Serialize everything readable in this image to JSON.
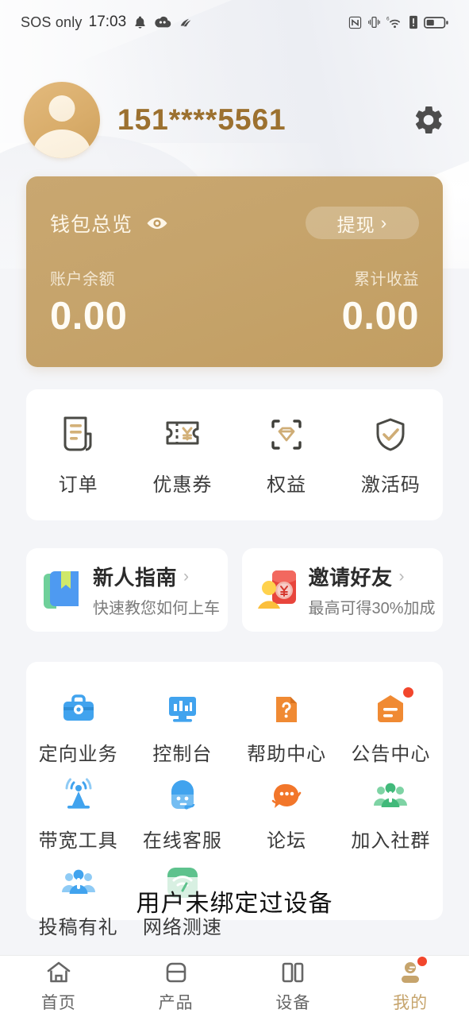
{
  "status_bar": {
    "carrier": "SOS only",
    "time": "17:03",
    "left_icons": [
      "bell-icon",
      "cloud-icon",
      "swoosh-icon"
    ],
    "right_icons": [
      "nfc-icon",
      "vibrate-icon",
      "wifi6-icon",
      "signal-alert-icon",
      "battery-icon"
    ]
  },
  "header": {
    "phone_number": "151****5561",
    "settings_icon": "gear-icon",
    "avatar": "user-avatar"
  },
  "wallet": {
    "title": "钱包总览",
    "eye_icon": "eye-icon",
    "withdraw_label": "提现",
    "balance_label": "账户余额",
    "balance_value": "0.00",
    "earnings_label": "累计收益",
    "earnings_value": "0.00",
    "card_color": "#c6a46c"
  },
  "quick_actions": [
    {
      "label": "订单",
      "icon": "document-icon"
    },
    {
      "label": "优惠券",
      "icon": "coupon-yen-icon"
    },
    {
      "label": "权益",
      "icon": "diamond-scan-icon"
    },
    {
      "label": "激活码",
      "icon": "shield-check-icon"
    }
  ],
  "banners": [
    {
      "title": "新人指南",
      "subtitle": "快速教您如何上车",
      "icon": "book-icon"
    },
    {
      "title": "邀请好友",
      "subtitle": "最高可得30%加成",
      "icon": "invite-redpacket-icon"
    }
  ],
  "services": [
    {
      "label": "定向业务",
      "icon": "briefcase-icon",
      "badge": false
    },
    {
      "label": "控制台",
      "icon": "monitor-chart-icon",
      "badge": false
    },
    {
      "label": "帮助中心",
      "icon": "question-doc-icon",
      "badge": false
    },
    {
      "label": "公告中心",
      "icon": "announcement-icon",
      "badge": true
    },
    {
      "label": "带宽工具",
      "icon": "antenna-icon",
      "badge": false
    },
    {
      "label": "在线客服",
      "icon": "headset-support-icon",
      "badge": false
    },
    {
      "label": "论坛",
      "icon": "chat-orbit-icon",
      "badge": false
    },
    {
      "label": "加入社群",
      "icon": "group-green-icon",
      "badge": false
    },
    {
      "label": "投稿有礼",
      "icon": "group-blue-icon",
      "badge": false
    },
    {
      "label": "网络测速",
      "icon": "speedtest-icon",
      "badge": false
    }
  ],
  "toast": {
    "message": "用户未绑定过设备"
  },
  "tabbar": {
    "accent_color": "#c6a46c",
    "items": [
      {
        "label": "首页",
        "icon": "home-icon",
        "active": false,
        "badge": false
      },
      {
        "label": "产品",
        "icon": "box-icon",
        "active": false,
        "badge": false
      },
      {
        "label": "设备",
        "icon": "device-columns-icon",
        "active": false,
        "badge": false
      },
      {
        "label": "我的",
        "icon": "person-icon",
        "active": true,
        "badge": true
      }
    ]
  }
}
